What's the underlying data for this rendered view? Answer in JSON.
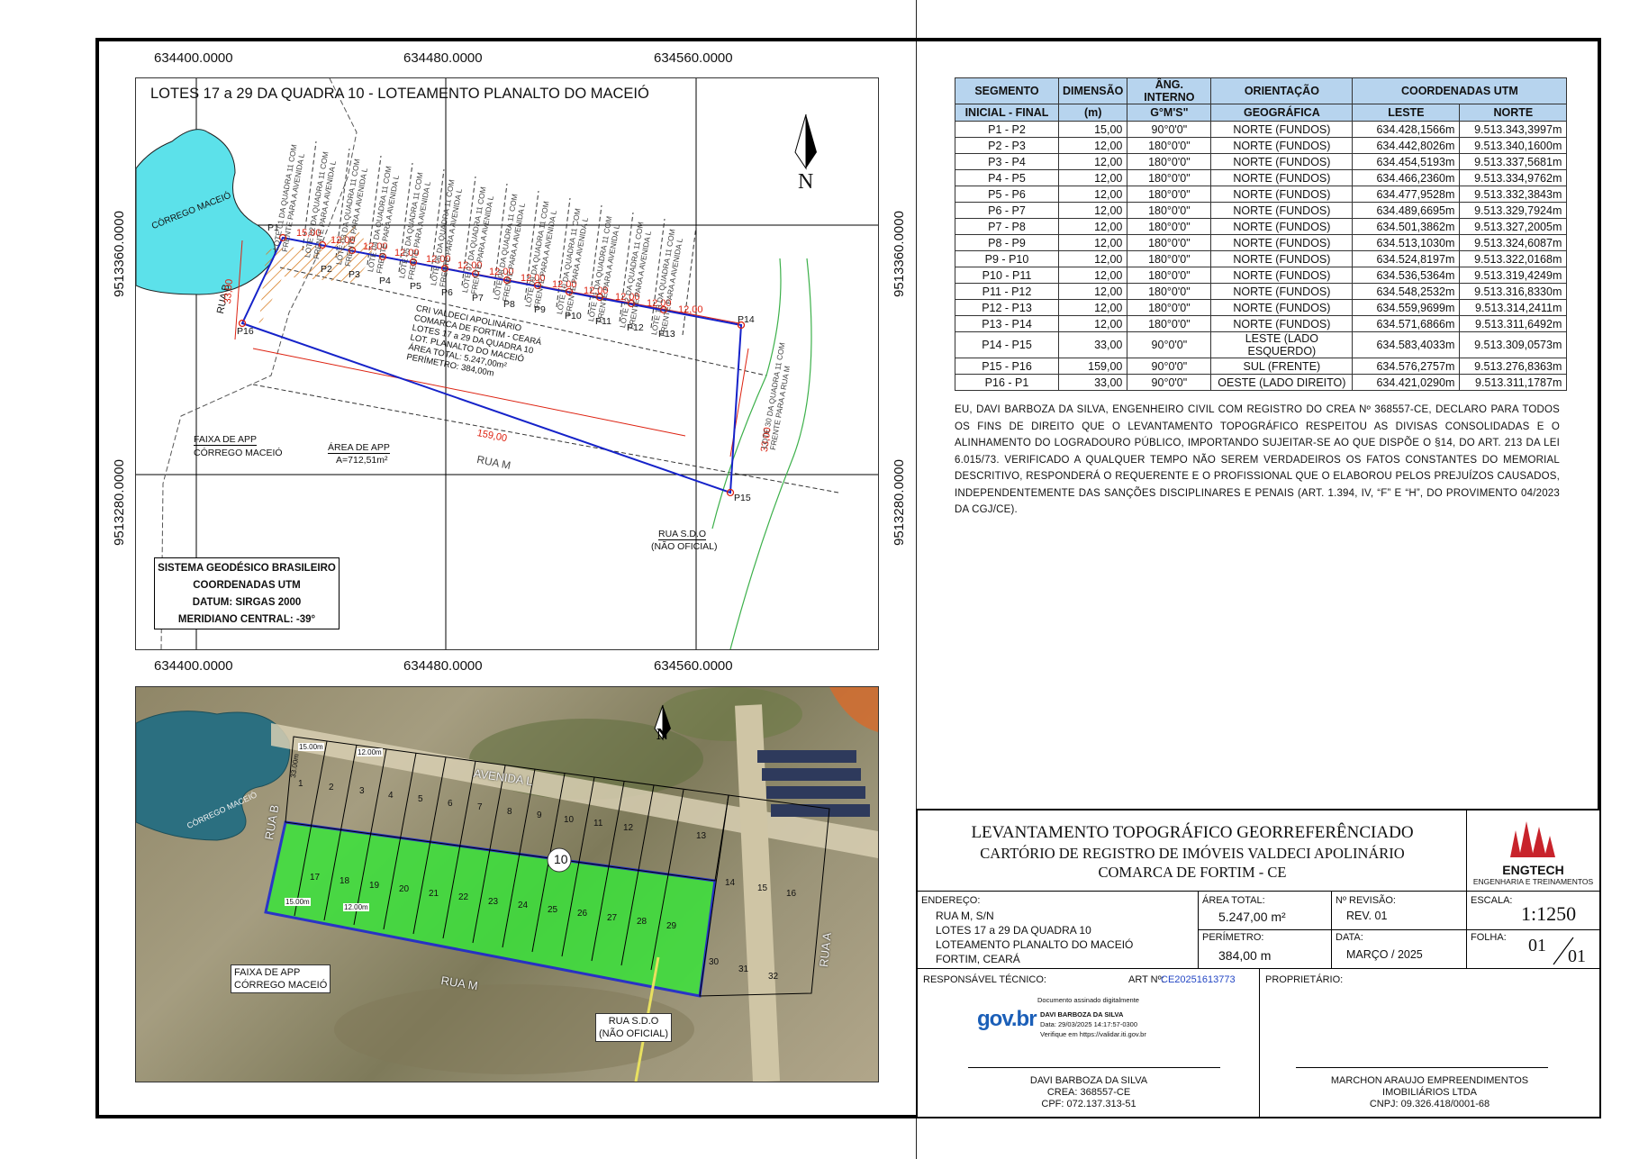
{
  "map": {
    "title": "LOTES 17 a 29 DA QUADRA 10 - LOTEAMENTO PLANALTO DO MACEIÓ",
    "x_coords": [
      "634400.0000",
      "634480.0000",
      "634560.0000"
    ],
    "y_coords": [
      "9513360.0000",
      "9513280.0000"
    ],
    "north": "N",
    "points": [
      "P1",
      "P2",
      "P3",
      "P4",
      "P5",
      "P6",
      "P7",
      "P8",
      "P9",
      "P10",
      "P11",
      "P12",
      "P13",
      "P14",
      "P15",
      "P16"
    ],
    "dims": [
      "15,00",
      "12,00",
      "12,00",
      "12,00",
      "12,00",
      "12,00",
      "12,00",
      "12,00",
      "12,00",
      "12,00",
      "12,00",
      "12,00",
      "12,00"
    ],
    "dim_left": "33,00",
    "dim_right": "33,00",
    "dim_bottom": "159,00",
    "lot_labels": [
      "LOTE 01 DA QUADRA 11 COM FRENTE PARA A AVENIDA L",
      "LOTE 02 DA QUADRA 11 COM FRENTE PARA A AVENIDA L",
      "LOTE 03 DA QUADRA 11 COM FRENTE PARA A AVENIDA L",
      "LOTE 04 DA QUADRA 11 COM FRENTE PARA A AVENIDA L",
      "LOTE 05 DA QUADRA 11 COM FRENTE PARA A AVENIDA L",
      "LOTE 06 DA QUADRA 11 COM FRENTE PARA A AVENIDA L",
      "LOTE 07 DA QUADRA 11 COM FRENTE PARA A AVENIDA L",
      "LOTE 08 DA QUADRA 11 COM FRENTE PARA A AVENIDA L",
      "LOTE 09 DA QUADRA 11 COM FRENTE PARA A AVENIDA L",
      "LOTE 10 DA QUADRA 11 COM FRENTE PARA A AVENIDA L",
      "LOTE 11 DA QUADRA 11 COM FRENTE PARA A AVENIDA L",
      "LOTE 12 DA QUADRA 11 COM FRENTE PARA A AVENIDA L",
      "LOTE 13 DA QUADRA 11 COM FRENTE PARA A AVENIDA L"
    ],
    "lot30": "LOTE 30 DA QUADRA 11 COM FRENTE PARA A RUA M",
    "corrego": "CÓRREGO MACEIÓ",
    "rua_b": "RUA B",
    "rua_m": "RUA M",
    "app_area_title": "ÁREA DE APP",
    "app_area_value": "A=712,51m²",
    "faixa_line1": "FAIXA DE APP",
    "faixa_line2": "CÓRREGO MACEIÓ",
    "rua_sdo_line1": "RUA S.D.O",
    "rua_sdo_line2": "(NÃO OFICIAL)",
    "center_info": [
      "CRI VALDECI APOLINÁRIO",
      "COMARCA DE FORTIM - CEARÁ",
      "LOTES 17 a 29 DA QUADRA 10",
      "LOT. PLANALTO DO MACEIÓ",
      "ÁREA TOTAL: 5.247,00m²",
      "PERÍMETRO: 384,00m"
    ],
    "sgb": [
      "SISTEMA GEODÉSICO BRASILEIRO",
      "COORDENADAS UTM",
      "DATUM: SIRGAS 2000",
      "MERIDIANO CENTRAL: -39°"
    ]
  },
  "photo": {
    "avenida": "AVENIDA L",
    "rua_b": "RUA B",
    "rua_m": "RUA M",
    "rua_a": "RUA A",
    "corrego": "CÓRREGO MACEIÓ",
    "faixa_line1": "FAIXA DE APP",
    "faixa_line2": "CÓRREGO MACEIÓ",
    "sdo_line1": "RUA S.D.O",
    "sdo_line2": "(NÃO OFICIAL)",
    "north": "N",
    "quadra": "10",
    "top_lots": [
      "1",
      "2",
      "3",
      "4",
      "5",
      "6",
      "7",
      "8",
      "9",
      "10",
      "11",
      "12",
      "13"
    ],
    "bottom_lots": [
      "17",
      "18",
      "19",
      "20",
      "21",
      "22",
      "23",
      "24",
      "25",
      "26",
      "27",
      "28",
      "29"
    ],
    "other_lots": [
      "14",
      "15",
      "16",
      "30",
      "31",
      "32"
    ],
    "dim_15": "15.00m",
    "dim_12": "12.00m",
    "dim_33": "33.00m"
  },
  "table": {
    "headers1": [
      "SEGMENTO",
      "DIMENSÃO",
      "ÂNG. INTERNO",
      "ORIENTAÇÃO",
      "COORDENADAS UTM"
    ],
    "headers2": [
      "INICIAL - FINAL",
      "(m)",
      "G°M'S\"",
      "GEOGRÁFICA",
      "LESTE",
      "NORTE"
    ],
    "rows": [
      [
        "P1 - P2",
        "15,00",
        "90°0'0\"",
        "NORTE (FUNDOS)",
        "634.428,1566m",
        "9.513.343,3997m"
      ],
      [
        "P2 - P3",
        "12,00",
        "180°0'0\"",
        "NORTE (FUNDOS)",
        "634.442,8026m",
        "9.513.340,1600m"
      ],
      [
        "P3 - P4",
        "12,00",
        "180°0'0\"",
        "NORTE (FUNDOS)",
        "634.454,5193m",
        "9.513.337,5681m"
      ],
      [
        "P4 - P5",
        "12,00",
        "180°0'0\"",
        "NORTE (FUNDOS)",
        "634.466,2360m",
        "9.513.334,9762m"
      ],
      [
        "P5 - P6",
        "12,00",
        "180°0'0\"",
        "NORTE (FUNDOS)",
        "634.477,9528m",
        "9.513.332,3843m"
      ],
      [
        "P6 - P7",
        "12,00",
        "180°0'0\"",
        "NORTE (FUNDOS)",
        "634.489,6695m",
        "9.513.329,7924m"
      ],
      [
        "P7 - P8",
        "12,00",
        "180°0'0\"",
        "NORTE (FUNDOS)",
        "634.501,3862m",
        "9.513.327,2005m"
      ],
      [
        "P8 - P9",
        "12,00",
        "180°0'0\"",
        "NORTE (FUNDOS)",
        "634.513,1030m",
        "9.513.324,6087m"
      ],
      [
        "P9 - P10",
        "12,00",
        "180°0'0\"",
        "NORTE (FUNDOS)",
        "634.524,8197m",
        "9.513.322,0168m"
      ],
      [
        "P10 - P11",
        "12,00",
        "180°0'0\"",
        "NORTE (FUNDOS)",
        "634.536,5364m",
        "9.513.319,4249m"
      ],
      [
        "P11 - P12",
        "12,00",
        "180°0'0\"",
        "NORTE (FUNDOS)",
        "634.548,2532m",
        "9.513.316,8330m"
      ],
      [
        "P12 - P13",
        "12,00",
        "180°0'0\"",
        "NORTE (FUNDOS)",
        "634.559,9699m",
        "9.513.314,2411m"
      ],
      [
        "P13 - P14",
        "12,00",
        "180°0'0\"",
        "NORTE (FUNDOS)",
        "634.571,6866m",
        "9.513.311,6492m"
      ],
      [
        "P14 - P15",
        "33,00",
        "90°0'0\"",
        "LESTE (LADO ESQUERDO)",
        "634.583,4033m",
        "9.513.309,0573m"
      ],
      [
        "P15 - P16",
        "159,00",
        "90°0'0\"",
        "SUL (FRENTE)",
        "634.576,2757m",
        "9.513.276,8363m"
      ],
      [
        "P16 - P1",
        "33,00",
        "90°0'0\"",
        "OESTE (LADO DIREITO)",
        "634.421,0290m",
        "9.513.311,1787m"
      ]
    ]
  },
  "declaration": "EU, DAVI BARBOZA DA SILVA, ENGENHEIRO CIVIL COM REGISTRO DO CREA Nº 368557-CE, DECLARO PARA TODOS OS FINS DE DIREITO QUE O LEVANTAMENTO TOPOGRÁFICO RESPEITOU AS DIVISAS CONSOLIDADAS E O ALINHAMENTO DO LOGRADOURO PÚBLICO, IMPORTANDO SUJEITAR-SE AO QUE DISPÕE O §14, DO ART. 213 DA LEI 6.015/73. VERIFICADO A QUALQUER TEMPO NÃO SEREM VERDADEIROS OS FATOS CONSTANTES DO MEMORIAL DESCRITIVO, RESPONDERÁ O REQUERENTE E O PROFISSIONAL QUE O ELABOROU PELOS PREJUÍZOS CAUSADOS, INDEPENDENTEMENTE DAS SANÇÕES DISCIPLINARES E PENAIS (ART. 1.394, IV, “F” E “H”, DO PROVIMENTO 04/2023 DA CGJ/CE).",
  "titleblock": {
    "title1": "LEVANTAMENTO TOPOGRÁFICO GEORREFERÊNCIADO",
    "title2": "CARTÓRIO DE REGISTRO DE IMÓVEIS VALDECI APOLINÁRIO",
    "title3": "COMARCA DE FORTIM - CE",
    "logo_name": "ENGTECH",
    "logo_sub": "ENGENHARIA E TREINAMENTOS",
    "endereco_label": "ENDEREÇO:",
    "endereco": [
      "RUA M, S/N",
      "LOTES 17 a 29 DA QUADRA 10",
      "LOTEAMENTO PLANALTO DO MACEIÓ",
      "FORTIM, CEARÁ"
    ],
    "area_label": "ÁREA TOTAL:",
    "area_value": "5.247,00 m²",
    "perimetro_label": "PERÍMETRO:",
    "perimetro_value": "384,00 m",
    "revisao_label": "Nº REVISÃO:",
    "revisao_value": "REV. 01",
    "data_label": "DATA:",
    "data_value": "MARÇO / 2025",
    "escala_label": "ESCALA:",
    "escala_value": "1:1250",
    "folha_label": "FOLHA:",
    "folha_num": "01",
    "folha_den": "01",
    "resp_label": "RESPONSÁVEL TÉCNICO:",
    "art_label": "ART Nº:",
    "art_value": "CE20251613773",
    "prop_label": "PROPRIETÁRIO:",
    "sign_doc": "Documento assinado digitalmente",
    "govbr": "gov.br",
    "sign_name": "DAVI BARBOZA DA SILVA",
    "sign_date": "Data: 29/03/2025 14:17:57-0300",
    "sign_verify": "Verifique em https://validar.iti.gov.br",
    "resp_name": "DAVI BARBOZA DA SILVA",
    "resp_crea": "CREA: 368557-CE",
    "resp_cpf": "CPF: 072.137.313-51",
    "prop_name1": "MARCHON ARAUJO EMPREENDIMENTOS",
    "prop_name2": "IMOBILIÁRIOS LTDA",
    "prop_cnpj": "CNPJ: 09.326.418/0001-68"
  }
}
